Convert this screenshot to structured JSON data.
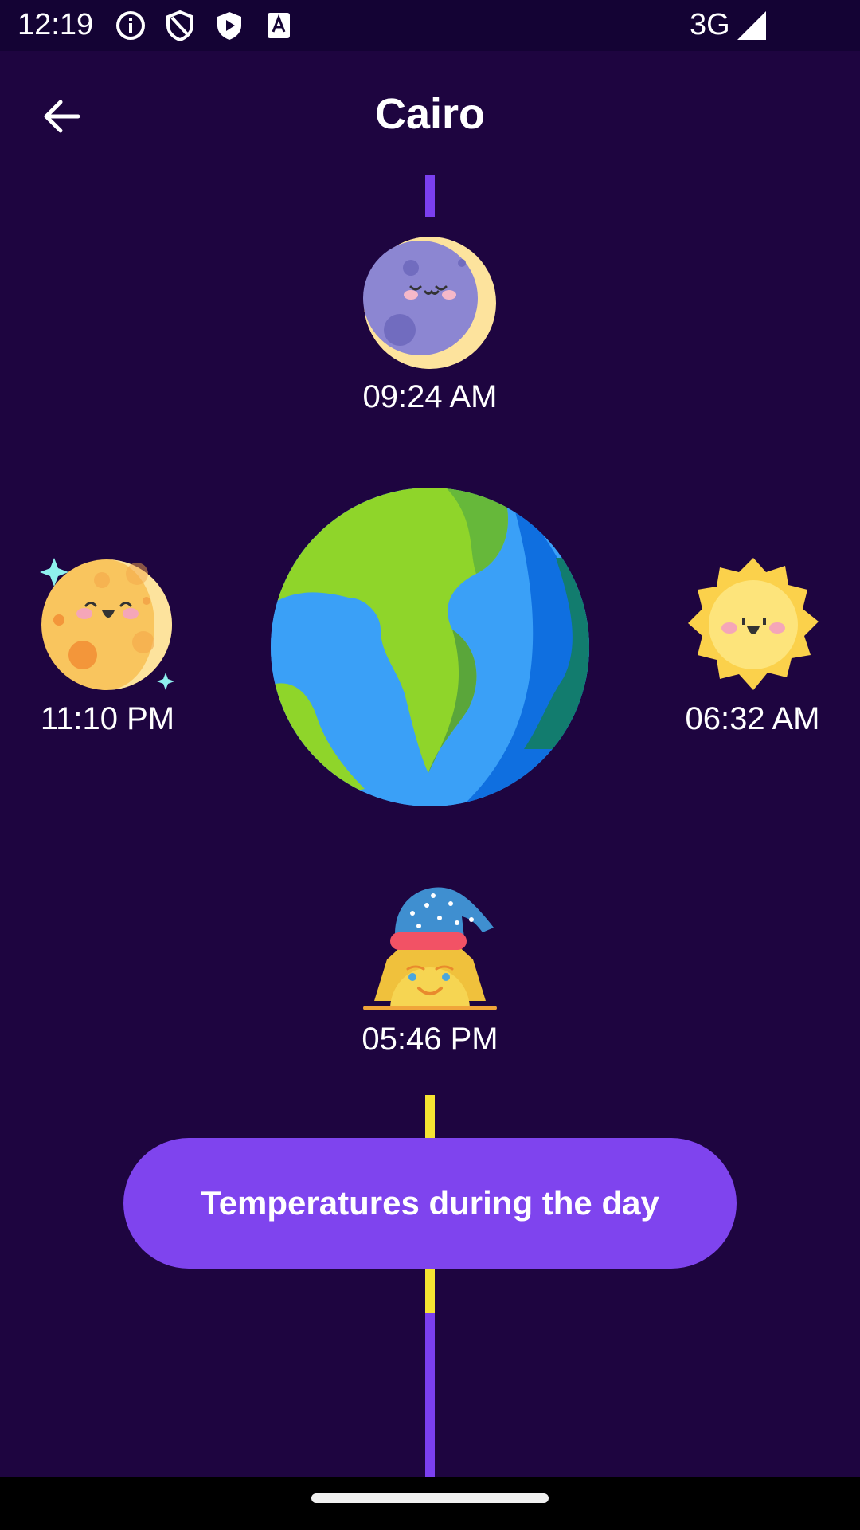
{
  "status_bar": {
    "time": "12:19",
    "network": "3G",
    "icons": [
      "info-icon",
      "shield-icon",
      "play-shield-icon",
      "keyboard-a-icon",
      "signal-icon"
    ]
  },
  "header": {
    "title": "Cairo",
    "back_icon": "arrow-left-icon"
  },
  "events": {
    "top": {
      "time": "09:24 AM",
      "icon": "sleeping-moon-icon"
    },
    "left": {
      "time": "11:10 PM",
      "icon": "happy-moon-icon"
    },
    "right": {
      "time": "06:32 AM",
      "icon": "happy-sun-icon"
    },
    "bottom": {
      "time": "05:46 PM",
      "icon": "sleepy-sunset-icon"
    },
    "center_icon": "earth-globe-icon"
  },
  "action_button": {
    "label": "Temperatures during the day"
  },
  "colors": {
    "background": "#1e0540",
    "accent": "#7f44ee",
    "line_purple": "#7b3ff0",
    "line_yellow": "#f6e432"
  }
}
